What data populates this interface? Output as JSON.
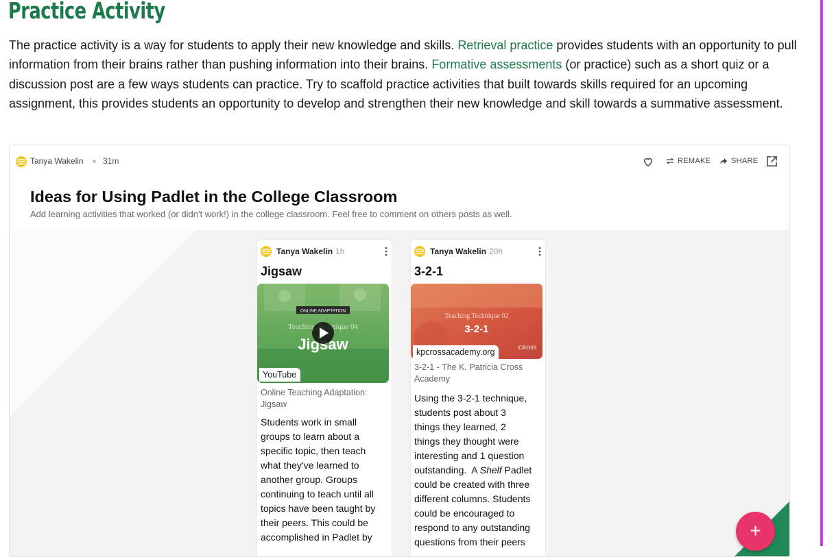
{
  "page": {
    "title": "Practice Activity",
    "intro": {
      "part1": "The practice activity is a way for students to apply their new knowledge and skills. ",
      "link1": "Retrieval practice",
      "part2": " provides students with an opportunity to pull information from their brains rather than pushing information into their brains. ",
      "link2": "Formative assessments",
      "part3": " (or practice) such as a short quiz or a discussion post are a few ways students can practice. Try to scaffold practice activities that built towards skills required for an upcoming assignment, this provides students an opportunity to develop and strengthen their new knowledge and skill towards a summative assessment."
    }
  },
  "padlet": {
    "author": "Tanya Wakelin",
    "time": "31m",
    "remake_label": "REMAKE",
    "share_label": "SHARE",
    "title": "Ideas for Using Padlet in the College Classroom",
    "subtitle": "Add learning activities that worked (or didn't work!) in the college classroom. Feel free to comment on others posts as well.",
    "add_label": "+",
    "posts": [
      {
        "author": "Tanya Wakelin",
        "time": "1h",
        "title": "Jigsaw",
        "thumb_badge": "ONLINE ADAPTATION",
        "thumb_line": "Teaching Technique 04",
        "thumb_big": "Jigsaw",
        "source": "YouTube",
        "caption": "Online Teaching Adaptation: Jigsaw",
        "body": [
          "Students work in small",
          "groups to learn about a",
          "specific topic, then teach",
          "what they've learned to",
          "another group. Groups",
          "continuing to teach until all",
          "topics have been taught by",
          "their peers. This could be",
          "accomplished in Padlet by"
        ]
      },
      {
        "author": "Tanya Wakelin",
        "time": "20h",
        "title": "3-2-1",
        "thumb_line": "Teaching Technique 02",
        "thumb_big": "3-2-1",
        "thumb_logo": "CROSS",
        "source": "kpcrossacademy.org",
        "caption": "3-2-1 - The K. Patricia Cross Academy",
        "body_lines": [
          "Using the 3-2-1 technique,",
          "students post about 3",
          "things they learned, 2",
          "things they thought were",
          "interesting and 1 question",
          "outstanding.  A "
        ],
        "body_italic": "Shelf",
        "body_after_italic": " Padlet",
        "body_rest": [
          "could be created with three",
          "different columns. Students",
          "could be encouraged to",
          "respond to any outstanding",
          "questions from their peers"
        ]
      }
    ]
  },
  "colors": {
    "heading_green": "#1c7a4c",
    "fab_pink": "#e8336b",
    "accent_purple": "#b44ec9"
  }
}
